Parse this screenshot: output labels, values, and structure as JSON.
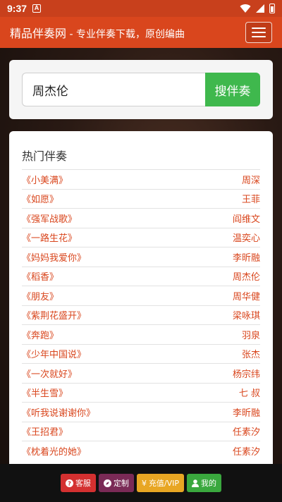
{
  "status_bar": {
    "time": "9:37",
    "notification_letter": "A"
  },
  "app_bar": {
    "title": "精品伴奏网",
    "subtitle": " - 专业伴奏下载，原创编曲",
    "menu_icon": "hamburger-icon"
  },
  "search": {
    "value": "周杰伦",
    "button_label": "搜伴奏"
  },
  "hot_list": {
    "title": "热门伴奏",
    "items": [
      {
        "song": "《小美满》",
        "artist": "周深"
      },
      {
        "song": "《如愿》",
        "artist": "王菲"
      },
      {
        "song": "《强军战歌》",
        "artist": "阎维文"
      },
      {
        "song": "《一路生花》",
        "artist": "温奕心"
      },
      {
        "song": "《妈妈我爱你》",
        "artist": "李昕融"
      },
      {
        "song": "《稻香》",
        "artist": "周杰伦"
      },
      {
        "song": "《朋友》",
        "artist": "周华健"
      },
      {
        "song": "《紫荆花盛开》",
        "artist": "梁咏琪"
      },
      {
        "song": "《奔跑》",
        "artist": "羽泉"
      },
      {
        "song": "《少年中国说》",
        "artist": "张杰"
      },
      {
        "song": "《一次就好》",
        "artist": "杨宗纬"
      },
      {
        "song": "《半生雪》",
        "artist": "七 叔"
      },
      {
        "song": "《听我说谢谢你》",
        "artist": "李昕融"
      },
      {
        "song": "《王招君》",
        "artist": "任素汐"
      },
      {
        "song": "《枕着光的她》",
        "artist": "任素汐"
      }
    ]
  },
  "bottom_bar": {
    "kefu": {
      "icon": "question-icon",
      "label": "客服"
    },
    "dingzhi": {
      "icon": "compass-icon",
      "label": "定制"
    },
    "vip": {
      "icon": "yen-icon",
      "label": "充值/VIP"
    },
    "mine": {
      "icon": "user-icon",
      "label": "我的"
    }
  },
  "colors": {
    "brand": "#d9461d",
    "search_button": "#3fb84d"
  }
}
